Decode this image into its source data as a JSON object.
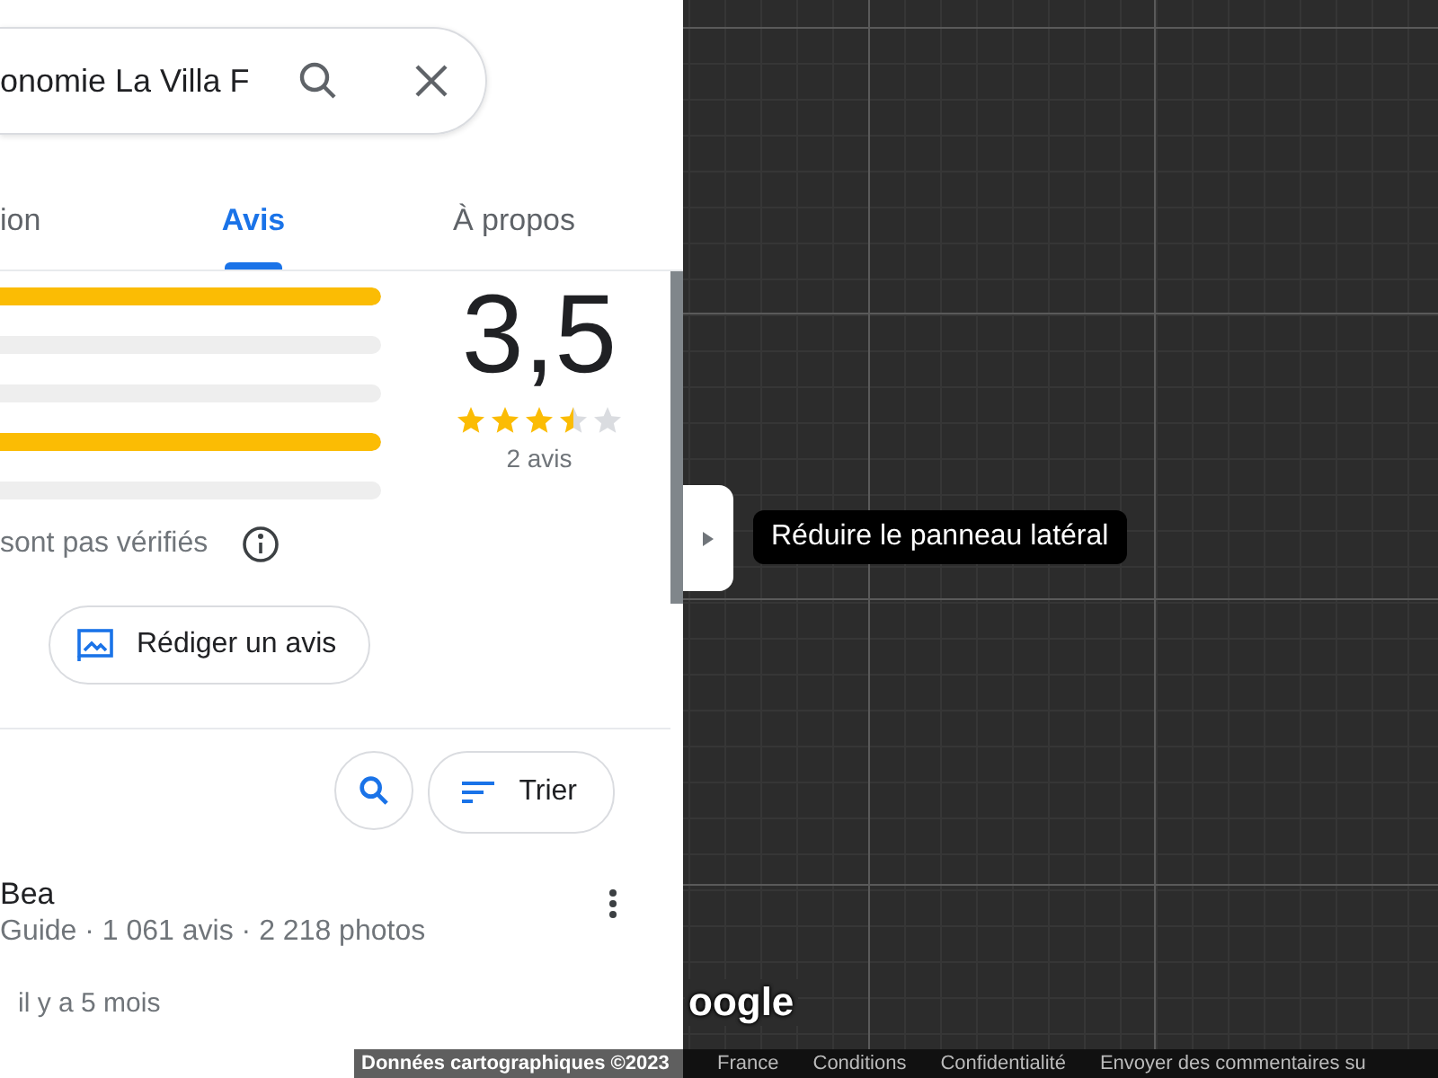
{
  "search": {
    "value": "onomie La Villa F"
  },
  "tabs": [
    {
      "label": "ion",
      "selected": false
    },
    {
      "label": "Avis",
      "selected": true
    },
    {
      "label": "À propos",
      "selected": false
    }
  ],
  "rating_bars": [
    {
      "level": 1
    },
    {
      "level": 0
    },
    {
      "level": 0
    },
    {
      "level": 1
    },
    {
      "level": 0
    }
  ],
  "rating": {
    "score": "3,5",
    "stars": 3.5,
    "count": "2 avis"
  },
  "notice": "sont pas vérifiés",
  "write_review": "Rédiger un avis",
  "sort_button": "Trier",
  "review": {
    "author": "Bea",
    "meta": "Guide · 1 061 avis · 2 218 photos",
    "time": "il y a 5 mois"
  },
  "map": {
    "tooltip": "Réduire le panneau latéral",
    "logo": "oogle"
  },
  "footer": {
    "attribution": "Données cartographiques ©2023",
    "links": [
      "France",
      "Conditions",
      "Confidentialité",
      "Envoyer des commentaires su"
    ]
  }
}
